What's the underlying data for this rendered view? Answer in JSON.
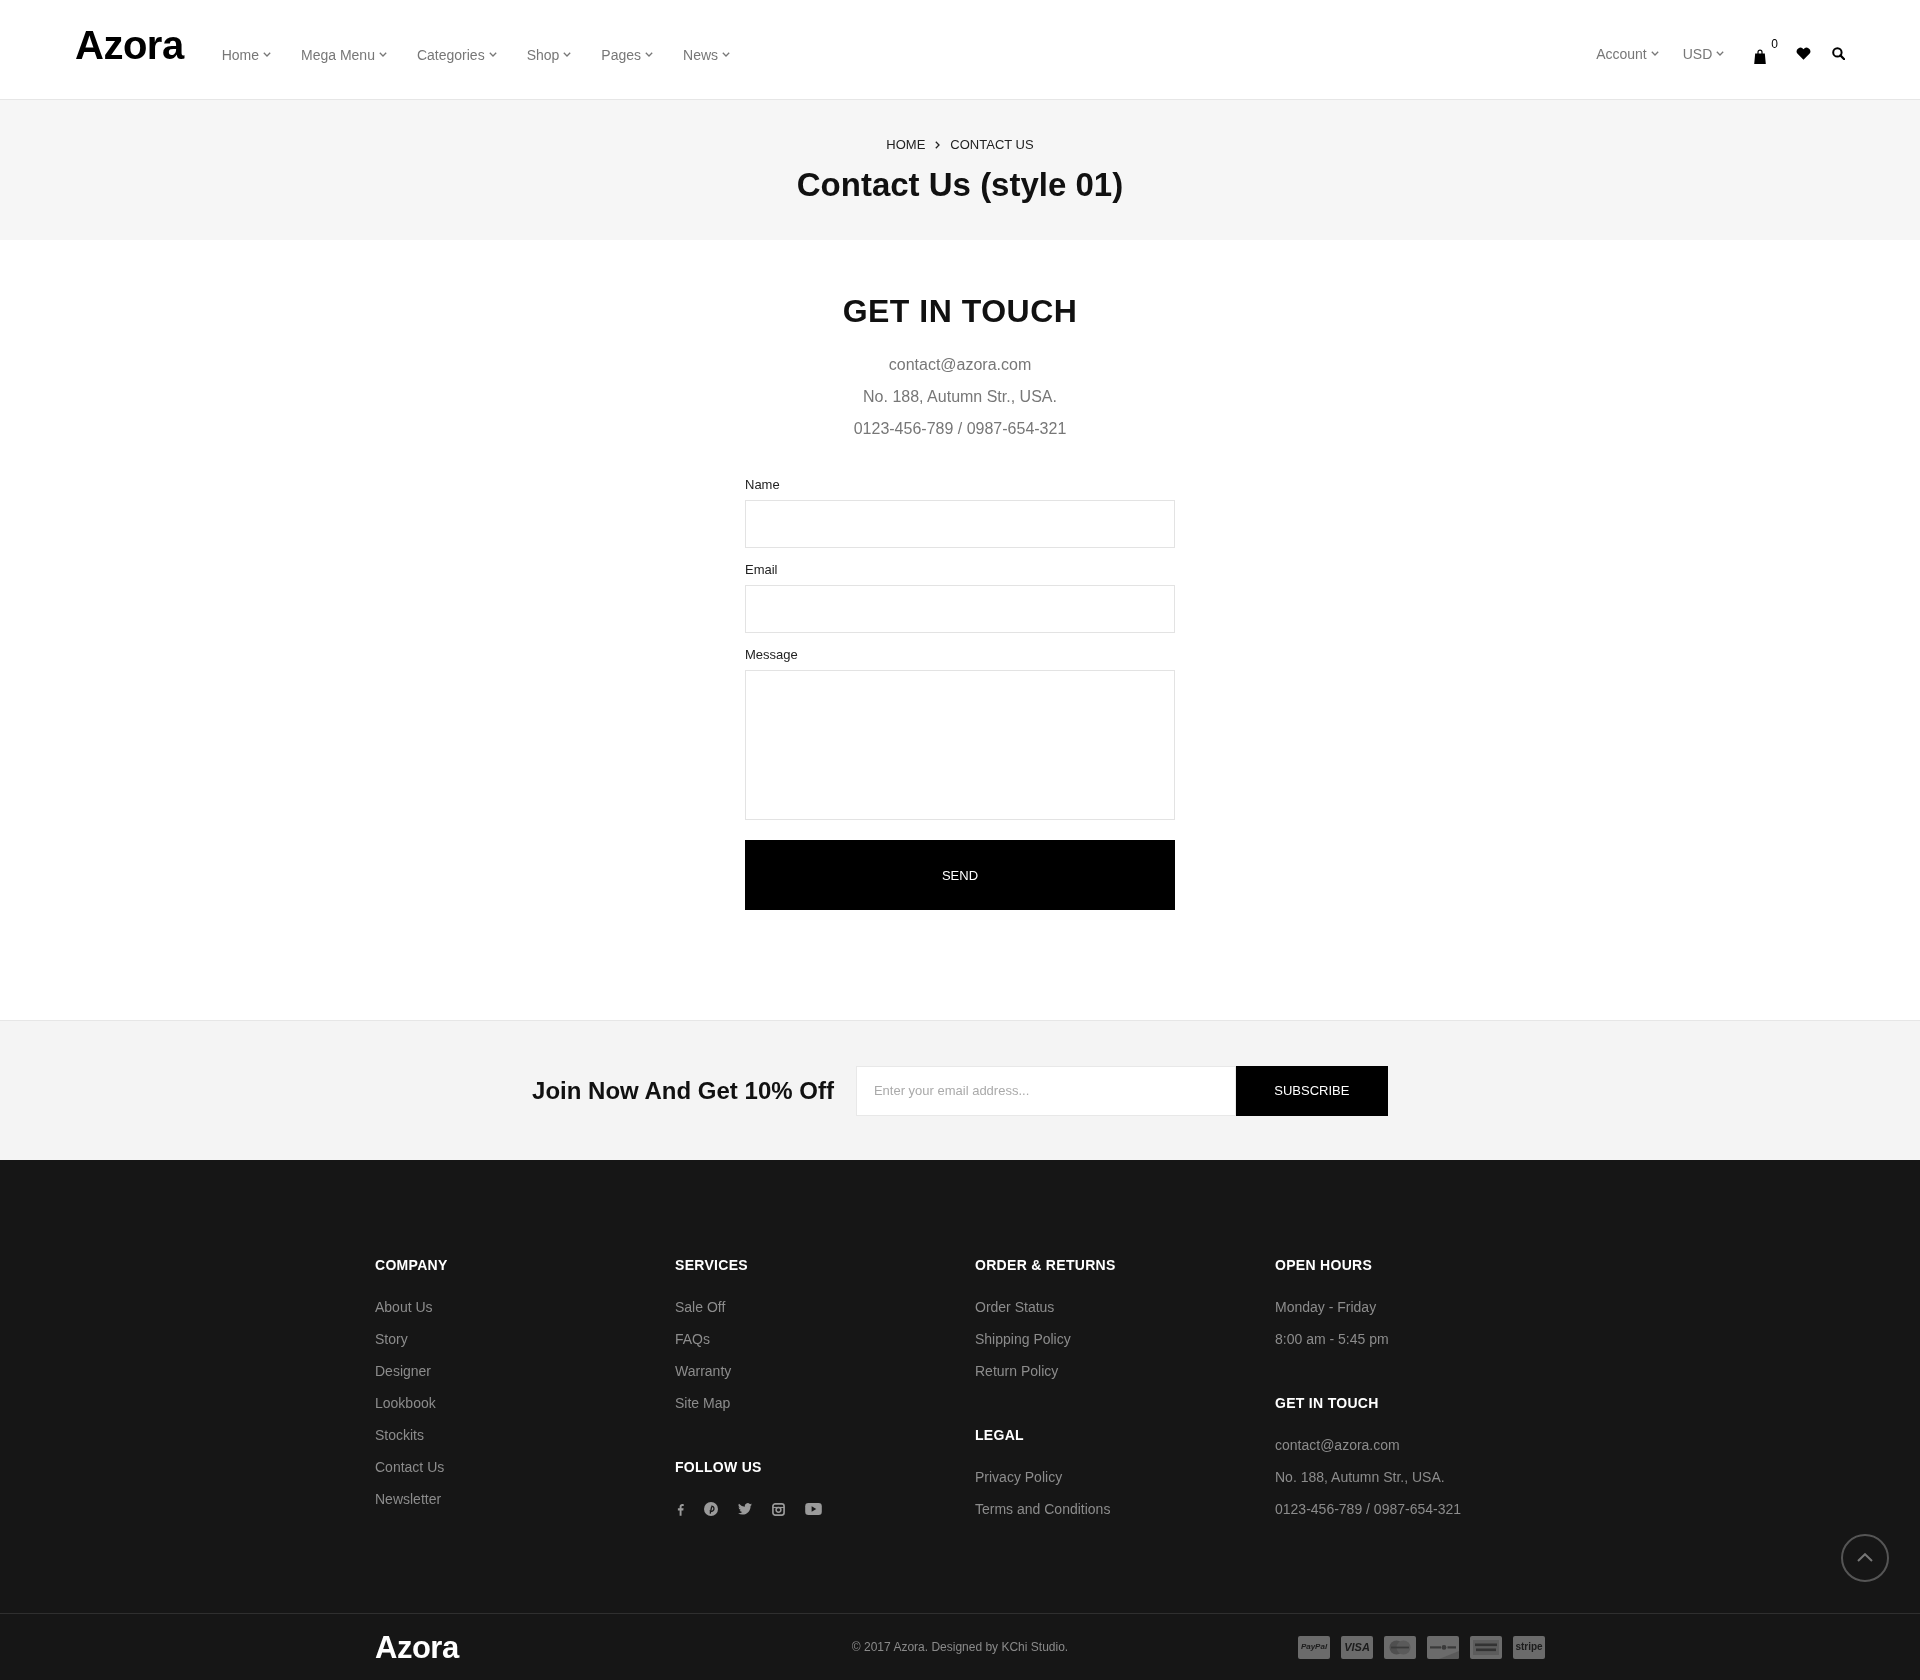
{
  "header": {
    "logo": "Azora",
    "nav": [
      {
        "label": "Home"
      },
      {
        "label": "Mega Menu"
      },
      {
        "label": "Categories"
      },
      {
        "label": "Shop"
      },
      {
        "label": "Pages"
      },
      {
        "label": "News"
      }
    ],
    "account": "Account",
    "currency": "USD",
    "cart_count": "0"
  },
  "page_title": {
    "breadcrumb": [
      "HOME",
      "CONTACT US"
    ],
    "title": "Contact Us (style 01)"
  },
  "contact": {
    "heading": "GET IN TOUCH",
    "lines": [
      "contact@azora.com",
      "No. 188, Autumn Str., USA.",
      "0123-456-789 / 0987-654-321"
    ],
    "fields": [
      {
        "label": "Name",
        "kind": "input"
      },
      {
        "label": "Email",
        "kind": "input"
      },
      {
        "label": "Message",
        "kind": "textarea"
      }
    ],
    "submit": "SEND"
  },
  "newsletter": {
    "title": "Join Now And Get 10% Off",
    "placeholder": "Enter your email address...",
    "button": "SUBSCRIBE"
  },
  "footer": {
    "columns": [
      {
        "sections": [
          {
            "heading": "COMPANY",
            "links": [
              "About Us",
              "Story",
              "Designer",
              "Lookbook",
              "Stockits",
              "Contact Us",
              "Newsletter"
            ]
          }
        ]
      },
      {
        "sections": [
          {
            "heading": "SERVICES",
            "links": [
              "Sale Off",
              "FAQs",
              "Warranty",
              "Site Map"
            ]
          },
          {
            "heading": "FOLLOW US",
            "social": [
              {
                "kind": "facebook"
              },
              {
                "kind": "pinterest"
              },
              {
                "kind": "twitter"
              },
              {
                "kind": "instagram"
              },
              {
                "kind": "youtube"
              }
            ]
          }
        ]
      },
      {
        "sections": [
          {
            "heading": "ORDER & RETURNS",
            "links": [
              "Order Status",
              "Shipping Policy",
              "Return Policy"
            ]
          },
          {
            "heading": "LEGAL",
            "links": [
              "Privacy Policy",
              "Terms and Conditions"
            ]
          }
        ]
      },
      {
        "sections": [
          {
            "heading": "OPEN HOURS",
            "lines": [
              "Monday - Friday",
              "8:00 am - 5:45 pm"
            ]
          },
          {
            "heading": "GET IN TOUCH",
            "lines": [
              "contact@azora.com",
              "No. 188, Autumn Str., USA.",
              "0123-456-789 / 0987-654-321"
            ]
          }
        ]
      }
    ],
    "logo": "Azora",
    "copyright": "© 2017 Azora. Designed by KChi Studio.",
    "payments": [
      {
        "label": "PayPal",
        "kind": "paypal"
      },
      {
        "label": "VISA",
        "kind": "visa"
      },
      {
        "kind": "mastercard"
      },
      {
        "kind": "discover"
      },
      {
        "kind": "amex"
      },
      {
        "label": "stripe",
        "kind": "stripe"
      }
    ]
  }
}
